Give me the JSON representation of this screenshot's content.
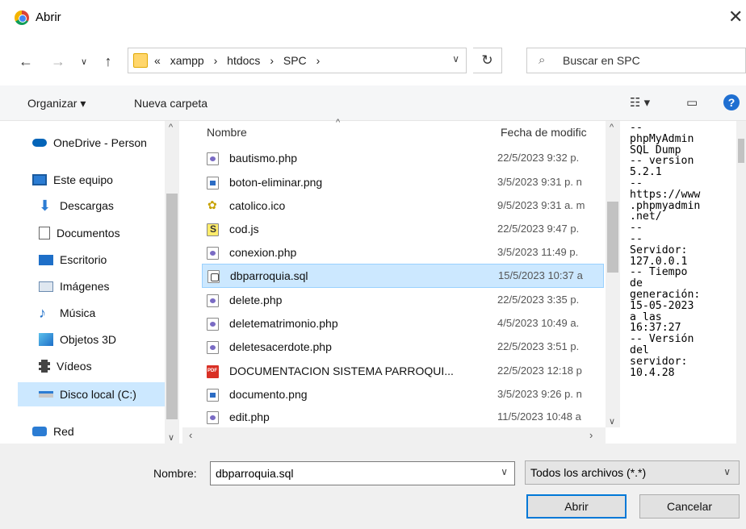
{
  "window": {
    "title": "Abrir"
  },
  "address": {
    "crumbs": [
      "«",
      "xampp",
      "›",
      "htdocs",
      "›",
      "SPC",
      "›"
    ]
  },
  "search": {
    "placeholder": "Buscar en SPC"
  },
  "toolbar": {
    "organize": "Organizar ▾",
    "new_folder": "Nueva carpeta",
    "help": "?"
  },
  "sidebar": {
    "items": [
      {
        "label": "OneDrive - Person"
      },
      {
        "label": "Este equipo"
      },
      {
        "label": "Descargas"
      },
      {
        "label": "Documentos"
      },
      {
        "label": "Escritorio"
      },
      {
        "label": "Imágenes"
      },
      {
        "label": "Música"
      },
      {
        "label": "Objetos 3D"
      },
      {
        "label": "Vídeos"
      },
      {
        "label": "Disco local (C:)"
      },
      {
        "label": "Red"
      }
    ],
    "colors": {
      "onedrive": "#0364b8",
      "selected_bg": "#cce8ff"
    }
  },
  "list": {
    "columns": {
      "name": "Nombre",
      "date": "Fecha de modific"
    },
    "files": [
      {
        "name": "bautismo.php",
        "date": "22/5/2023 9:32 p.",
        "kind": "php"
      },
      {
        "name": "boton-eliminar.png",
        "date": "3/5/2023 9:31 p. n",
        "kind": "img"
      },
      {
        "name": "catolico.ico",
        "date": "9/5/2023 9:31 a. m",
        "kind": "ico"
      },
      {
        "name": "cod.js",
        "date": "22/5/2023 9:47 p.",
        "kind": "js"
      },
      {
        "name": "conexion.php",
        "date": "3/5/2023 11:49 p.",
        "kind": "php"
      },
      {
        "name": "dbparroquia.sql",
        "date": "15/5/2023 10:37 a",
        "kind": "sql",
        "selected": true
      },
      {
        "name": "delete.php",
        "date": "22/5/2023 3:35 p.",
        "kind": "php"
      },
      {
        "name": "deletematrimonio.php",
        "date": "4/5/2023 10:49 a.",
        "kind": "php"
      },
      {
        "name": "deletesacerdote.php",
        "date": "22/5/2023 3:51 p.",
        "kind": "php"
      },
      {
        "name": "DOCUMENTACION SISTEMA PARROQUI...",
        "date": "22/5/2023 12:18 p",
        "kind": "pdf"
      },
      {
        "name": "documento.png",
        "date": "3/5/2023 9:26 p. n",
        "kind": "img"
      },
      {
        "name": "edit.php",
        "date": "11/5/2023 10:48 a",
        "kind": "php"
      }
    ]
  },
  "preview": {
    "text": "--\nphpMyAdmin\nSQL Dump\n-- version\n5.2.1\n--\nhttps://www\n.phpmyadmin\n.net/\n--\n--\nServidor:\n127.0.0.1\n-- Tiempo\nde\ngeneración:\n15-05-2023\na las\n16:37:27\n-- Versión\ndel\nservidor:\n10.4.28"
  },
  "footer": {
    "name_label": "Nombre:",
    "name_value": "dbparroquia.sql",
    "filter_value": "Todos los archivos (*.*)",
    "open_button": "Abrir",
    "cancel_button": "Cancelar"
  }
}
